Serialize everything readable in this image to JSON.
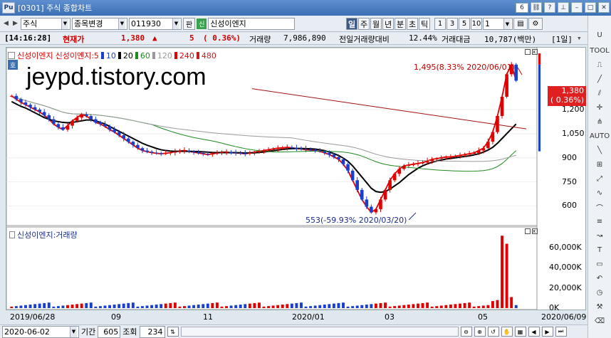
{
  "window": {
    "app_icon": "Pu",
    "title": "[0301] 주식 종합차트",
    "win_number": "6"
  },
  "toolbar": {
    "market": "주식",
    "item_change": "종목변경",
    "code": "011930",
    "pan_label": "판",
    "badge": "신",
    "stock_name": "신성이엔지",
    "period_tabs": [
      "일",
      "주",
      "월",
      "년",
      "분",
      "초",
      "틱"
    ],
    "active_tab": "일",
    "unit_buttons": [
      "1",
      "3",
      "5",
      "10"
    ],
    "unit_value": "1"
  },
  "info": {
    "time": "[14:16:28]",
    "cur_label": "현재가",
    "price": "1,380",
    "arrow": "▲",
    "change": "5",
    "change_pct": "( 0.36%)",
    "volume_label": "거래량",
    "volume": "7,986,890",
    "prev_ratio_label": "전일거래량대비",
    "prev_ratio": "12.44%",
    "amount_label": "거래대금",
    "amount": "10,787(백만)",
    "period": "[1일]"
  },
  "chart": {
    "watermark": "jeypd.tistory.com",
    "legend_badge": "호",
    "legend_items": [
      {
        "label": "신성이엔지",
        "color": "#e00000"
      },
      {
        "label": "신성이엔지:5",
        "color": "#e00000"
      },
      {
        "label": "10",
        "color": "#1a3fd0"
      },
      {
        "label": "20",
        "color": "#000000"
      },
      {
        "label": "60",
        "color": "#1e8a1e"
      },
      {
        "label": "120",
        "color": "#9a9a9a"
      },
      {
        "label": "240",
        "color": "#e00000"
      },
      {
        "label": "480",
        "color": "#c02020"
      }
    ],
    "high_annotation": "1,495(8.33% 2020/06/01)",
    "low_annotation": "553(-59.93% 2020/03/20)",
    "price_box": {
      "price": "1,380",
      "pct": "( 0.36%)"
    },
    "y_ticks": [
      "1,200",
      "1,050",
      "900",
      "750",
      "600"
    ],
    "volume_legend": "신성이엔지:거래량",
    "volume_ticks": [
      "60,000K",
      "40,000K",
      "20,000K",
      "0K"
    ],
    "x_labels": [
      "2019/06/28",
      "09",
      "11",
      "2020/01",
      "03",
      "05",
      "2020/06/09"
    ]
  },
  "bottom": {
    "date": "2020-06-02",
    "period_label": "기간",
    "period_value": "605",
    "view_label": "조회",
    "view_value": "234"
  },
  "chart_data": {
    "type": "candlestick",
    "x_range": [
      "2019/06/28",
      "2020/06/09"
    ],
    "price_ticks": [
      1200,
      1050,
      900,
      750,
      600
    ],
    "high": {
      "value": 1495,
      "pct": 8.33,
      "date": "2020/06/01"
    },
    "low": {
      "value": 553,
      "pct": -59.93,
      "date": "2020/03/20"
    },
    "close_series": [
      1285,
      1265,
      1245,
      1230,
      1215,
      1200,
      1185,
      1165,
      1140,
      1110,
      1090,
      1075,
      1100,
      1130,
      1150,
      1170,
      1160,
      1140,
      1120,
      1110,
      1095,
      1075,
      1060,
      1040,
      1020,
      1000,
      980,
      960,
      945,
      938,
      932,
      928,
      925,
      928,
      932,
      938,
      942,
      945,
      940,
      935,
      930,
      925,
      920,
      925,
      930,
      935,
      935,
      932,
      930,
      928,
      925,
      930,
      935,
      940,
      945,
      950,
      955,
      960,
      962,
      965,
      962,
      958,
      955,
      950,
      948,
      945,
      940,
      930,
      920,
      905,
      890,
      860,
      820,
      760,
      700,
      640,
      595,
      560,
      580,
      640,
      700,
      760,
      800,
      830,
      850,
      855,
      860,
      865,
      870,
      880,
      890,
      895,
      900,
      905,
      905,
      910,
      915,
      920,
      925,
      930,
      945,
      960,
      1000,
      1060,
      1160,
      1280,
      1420,
      1480,
      1380
    ],
    "ma20_series": [
      1250,
      1235,
      1220,
      1210,
      1195,
      1180,
      1165,
      1150,
      1140,
      1130,
      1125,
      1120,
      1118,
      1120,
      1125,
      1130,
      1135,
      1135,
      1130,
      1120,
      1110,
      1095,
      1080,
      1065,
      1050,
      1035,
      1020,
      1005,
      990,
      978,
      968,
      958,
      950,
      945,
      942,
      940,
      940,
      940,
      940,
      939,
      938,
      937,
      935,
      933,
      932,
      932,
      932,
      932,
      932,
      931,
      930,
      930,
      931,
      933,
      936,
      940,
      944,
      948,
      952,
      955,
      957,
      958,
      958,
      957,
      956,
      954,
      950,
      944,
      936,
      926,
      914,
      898,
      878,
      850,
      815,
      780,
      745,
      710,
      690,
      685,
      690,
      705,
      725,
      745,
      770,
      795,
      815,
      835,
      850,
      862,
      872,
      880,
      886,
      892,
      896,
      900,
      904,
      908,
      912,
      918,
      925,
      935,
      948,
      965,
      990,
      1020,
      1050,
      1080,
      1110
    ]
  }
}
